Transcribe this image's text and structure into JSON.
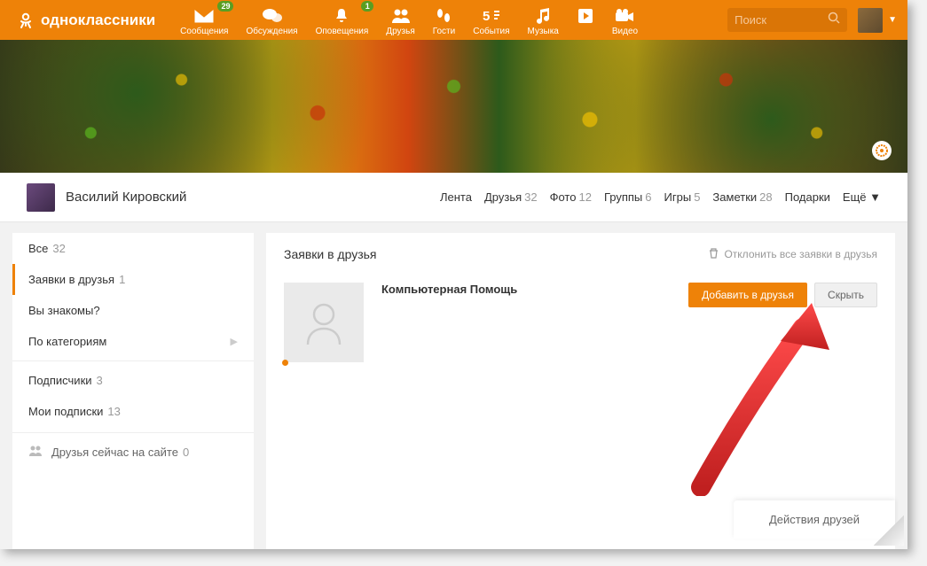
{
  "brand": "одноклассники",
  "nav": {
    "messages": {
      "label": "Сообщения",
      "badge": "29"
    },
    "discussions": {
      "label": "Обсуждения"
    },
    "notifications": {
      "label": "Оповещения",
      "badge": "1"
    },
    "friends": {
      "label": "Друзья"
    },
    "guests": {
      "label": "Гости"
    },
    "events": {
      "label": "События"
    },
    "music": {
      "label": "Музыка"
    },
    "video": {
      "label": "Видео"
    }
  },
  "search_placeholder": "Поиск",
  "profile": {
    "name": "Василий Кировский",
    "tabs": {
      "feed": "Лента",
      "friends": "Друзья",
      "friends_count": "32",
      "photo": "Фото",
      "photo_count": "12",
      "groups": "Группы",
      "groups_count": "6",
      "games": "Игры",
      "games_count": "5",
      "notes": "Заметки",
      "notes_count": "28",
      "gifts": "Подарки",
      "more": "Ещё ▼"
    }
  },
  "sidebar": {
    "all": "Все",
    "all_count": "32",
    "requests": "Заявки в друзья",
    "requests_count": "1",
    "familiar": "Вы знакомы?",
    "categories": "По категориям",
    "subscribers": "Подписчики",
    "subscribers_count": "3",
    "subscriptions": "Мои подписки",
    "subscriptions_count": "13",
    "online": "Друзья сейчас на сайте",
    "online_count": "0"
  },
  "content": {
    "title": "Заявки в друзья",
    "reject_all": "Отклонить все заявки в друзья",
    "request_name": "Компьютерная Помощь",
    "add_btn": "Добавить в друзья",
    "hide_btn": "Скрыть"
  },
  "bottom": {
    "friends_actions": "Действия друзей"
  }
}
